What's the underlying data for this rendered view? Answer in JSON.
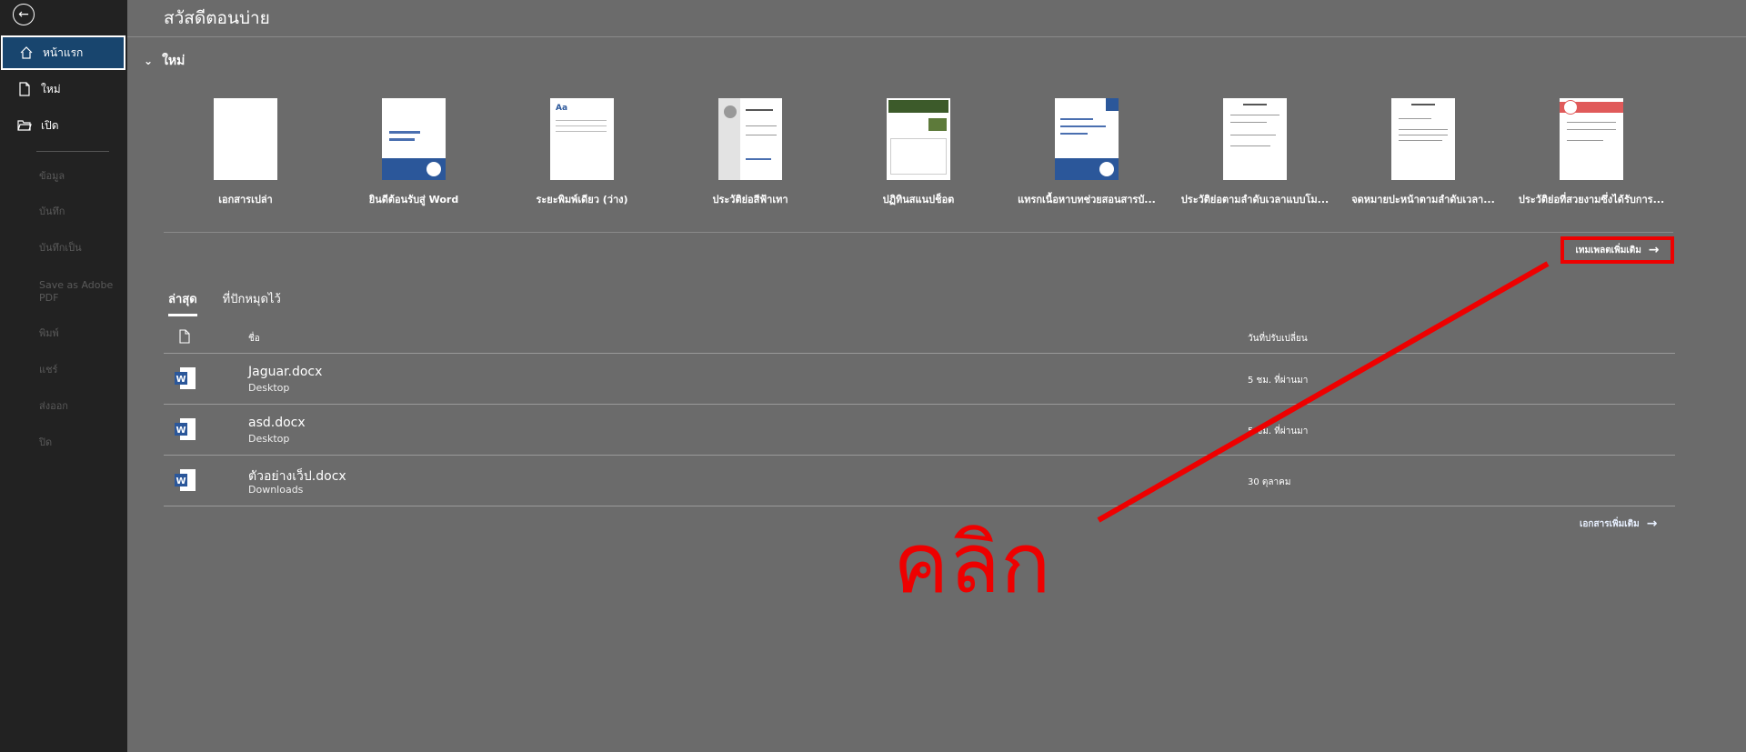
{
  "sidebar": {
    "items": [
      {
        "label": "หน้าแรก",
        "icon": "home-icon",
        "active": true
      },
      {
        "label": "ใหม่",
        "icon": "new-doc-icon",
        "active": false
      },
      {
        "label": "เปิด",
        "icon": "folder-open-icon",
        "active": false
      }
    ],
    "sub_items": [
      "ข้อมูล",
      "บันทึก",
      "บันทึกเป็น",
      "Save as Adobe PDF",
      "พิมพ์",
      "แชร์",
      "ส่งออก",
      "ปิด"
    ]
  },
  "header": {
    "greeting": "สวัสดีตอนบ่าย"
  },
  "new_section": {
    "title": "ใหม่",
    "templates": [
      {
        "label": "เอกสารเปล่า"
      },
      {
        "label": "ยินดีต้อนรับสู่ Word"
      },
      {
        "label": "ระยะพิมพ์เดียว (ว่าง)"
      },
      {
        "label": "ประวัติย่อสีฟ้าเทา"
      },
      {
        "label": "ปฏิทินสแนปช็อต"
      },
      {
        "label": "แทรกเนื้อหาบทช่วยสอนสารบั..."
      },
      {
        "label": "ประวัติย่อตามลำดับเวลาแบบโม..."
      },
      {
        "label": "จดหมายปะหน้าตามลำดับเวลา..."
      },
      {
        "label": "ประวัติย่อที่สวยงามซึ่งได้รับการ..."
      }
    ],
    "more_templates": "เทมเพลตเพิ่มเติม"
  },
  "recent": {
    "tabs": [
      "ล่าสุด",
      "ที่ปักหมุดไว้"
    ],
    "columns": {
      "name": "ชื่อ",
      "modified": "วันที่ปรับเปลี่ยน"
    },
    "rows": [
      {
        "name": "Jaguar.docx",
        "location": "Desktop",
        "modified": "5 ชม. ที่ผ่านมา"
      },
      {
        "name": "asd.docx",
        "location": "Desktop",
        "modified": "5 ชม. ที่ผ่านมา"
      },
      {
        "name": "ตัวอย่างเว็ป.docx",
        "location": "Downloads",
        "modified": "30 ตุลาคม"
      }
    ],
    "more_docs": "เอกสารเพิ่มเติม"
  },
  "annotation": {
    "text": "คลิก",
    "color": "#e00000"
  },
  "colors": {
    "accent": "#18456e",
    "word_blue": "#2b579a"
  }
}
